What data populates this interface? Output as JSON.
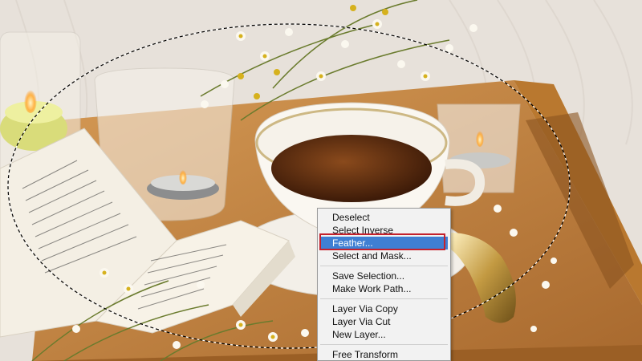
{
  "context_menu": {
    "items": [
      {
        "label": "Deselect"
      },
      {
        "label": "Select Inverse"
      },
      {
        "label": "Feather...",
        "highlighted": true
      },
      {
        "label": "Select and Mask..."
      },
      {
        "label": "Save Selection..."
      },
      {
        "label": "Make Work Path..."
      },
      {
        "label": "Layer Via Copy"
      },
      {
        "label": "Layer Via Cut"
      },
      {
        "label": "New Layer..."
      },
      {
        "label": "Free Transform"
      }
    ]
  },
  "colors": {
    "menu_background": "#f2f2f2",
    "menu_highlight": "#3f7fd3",
    "annotation_border": "#c4212c",
    "tray_wood": "#c88a45"
  },
  "icons": [
    "candle-icon",
    "teacup-icon",
    "book-icon",
    "daisy-icon"
  ]
}
